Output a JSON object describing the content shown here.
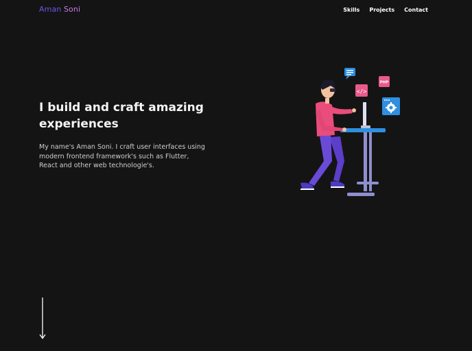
{
  "header": {
    "logo_first": "Aman",
    "logo_last": "Soni",
    "nav": [
      {
        "label": "Skills"
      },
      {
        "label": "Projects"
      },
      {
        "label": "Contact"
      }
    ]
  },
  "hero": {
    "headline": "I build and craft amazing experiences",
    "intro": "My name's Aman Soni. I craft user interfaces using modern frontend framework's such as Flutter, React and other web technologie's.",
    "illustration_icons": [
      "chat-bubble-icon",
      "code-icon",
      "php-icon",
      "gear-icon"
    ],
    "php_badge": "PHP"
  },
  "scroll": {
    "icon": "arrow-down-icon"
  },
  "colors": {
    "background": "#151415",
    "logo_first": "#6f55e6",
    "logo_last": "#c87ae6",
    "text": "#ffffff"
  }
}
